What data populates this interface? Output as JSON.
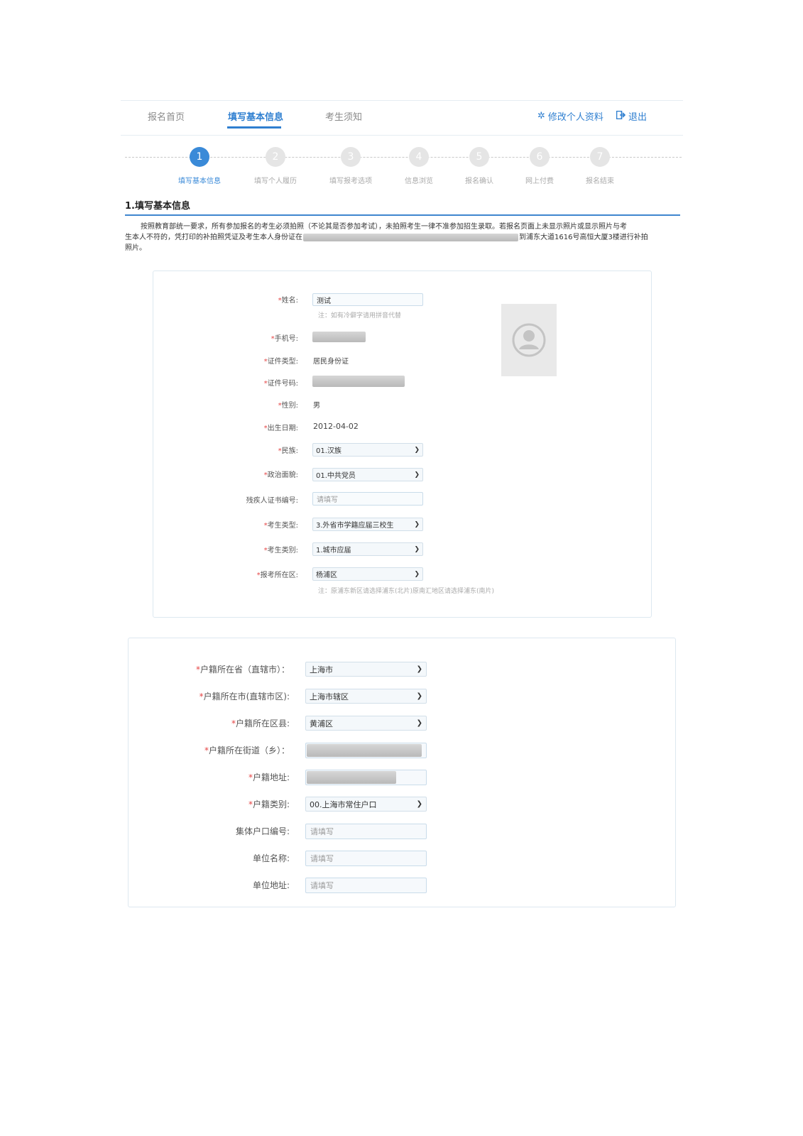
{
  "nav": {
    "items": [
      {
        "label": "报名首页",
        "active": false
      },
      {
        "label": "填写基本信息",
        "active": true
      },
      {
        "label": "考生须知",
        "active": false
      }
    ],
    "edit_profile": "修改个人资料",
    "logout": "退出"
  },
  "steps": [
    {
      "num": "1",
      "label": "填写基本信息",
      "active": true
    },
    {
      "num": "2",
      "label": "填写个人履历",
      "active": false
    },
    {
      "num": "3",
      "label": "填写报考选项",
      "active": false
    },
    {
      "num": "4",
      "label": "信息浏览",
      "active": false
    },
    {
      "num": "5",
      "label": "报名确认",
      "active": false
    },
    {
      "num": "6",
      "label": "网上付费",
      "active": false
    },
    {
      "num": "7",
      "label": "报名结束",
      "active": false
    }
  ],
  "section": {
    "title": "1.填写基本信息",
    "notice_line1": "按照教育部统一要求，所有参加报名的考生必须拍照（不论其是否参加考试），未拍照考生一律不准参加招生录取。若报名页面上未显示照片或显示照片与考",
    "notice_line2a": "生本人不符的，凭打印的补拍照凭证及考生本人身份证在",
    "notice_line2b": "到浦东大道1616号高恒大厦3楼进行补拍",
    "notice_line3": "照片。"
  },
  "basic": {
    "name_label": "姓名:",
    "name_value": "测试",
    "name_hint": "注：如有冷僻字请用拼音代替",
    "phone_label": "手机号:",
    "id_type_label": "证件类型:",
    "id_type_value": "居民身份证",
    "id_no_label": "证件号码:",
    "gender_label": "性别:",
    "gender_value": "男",
    "dob_label": "出生日期:",
    "dob_value": "2012-04-02",
    "ethnic_label": "民族:",
    "ethnic_value": "01.汉族",
    "political_label": "政治面貌:",
    "political_value": "01.中共党员",
    "disability_label": "残疾人证书编号:",
    "disability_placeholder": "请填写",
    "cand_type_label": "考生类型:",
    "cand_type_value": "3.外省市学籍应届三校生",
    "cand_cat_label": "考生类别:",
    "cand_cat_value": "1.城市应届",
    "district_label": "报考所在区:",
    "district_value": "杨浦区",
    "district_hint": "注：原浦东新区请选择浦东(北片)原南汇地区请选择浦东(南片)"
  },
  "household": {
    "province_label": "户籍所在省（直辖市）：",
    "province_value": "上海市",
    "city_label": "户籍所在市(直辖市区):",
    "city_value": "上海市辖区",
    "county_label": "户籍所在区县:",
    "county_value": "黄浦区",
    "street_label": "户籍所在街道（乡）：",
    "address_label": "户籍地址:",
    "type_label": "户籍类别:",
    "type_value": "00.上海市常住户口",
    "collective_label": "集体户口编号:",
    "collective_placeholder": "请填写",
    "unit_name_label": "单位名称:",
    "unit_name_placeholder": "请填写",
    "unit_addr_label": "单位地址:",
    "unit_addr_placeholder": "请填写"
  },
  "required_mark": "*",
  "colors": {
    "accent": "#2f7fd0",
    "required": "#e54545",
    "step_inactive": "#e5e5e5"
  },
  "icons": {
    "edit_profile": "gear-icon",
    "logout": "logout-icon",
    "photo": "avatar-placeholder-icon",
    "select": "chevron-down-icon"
  }
}
